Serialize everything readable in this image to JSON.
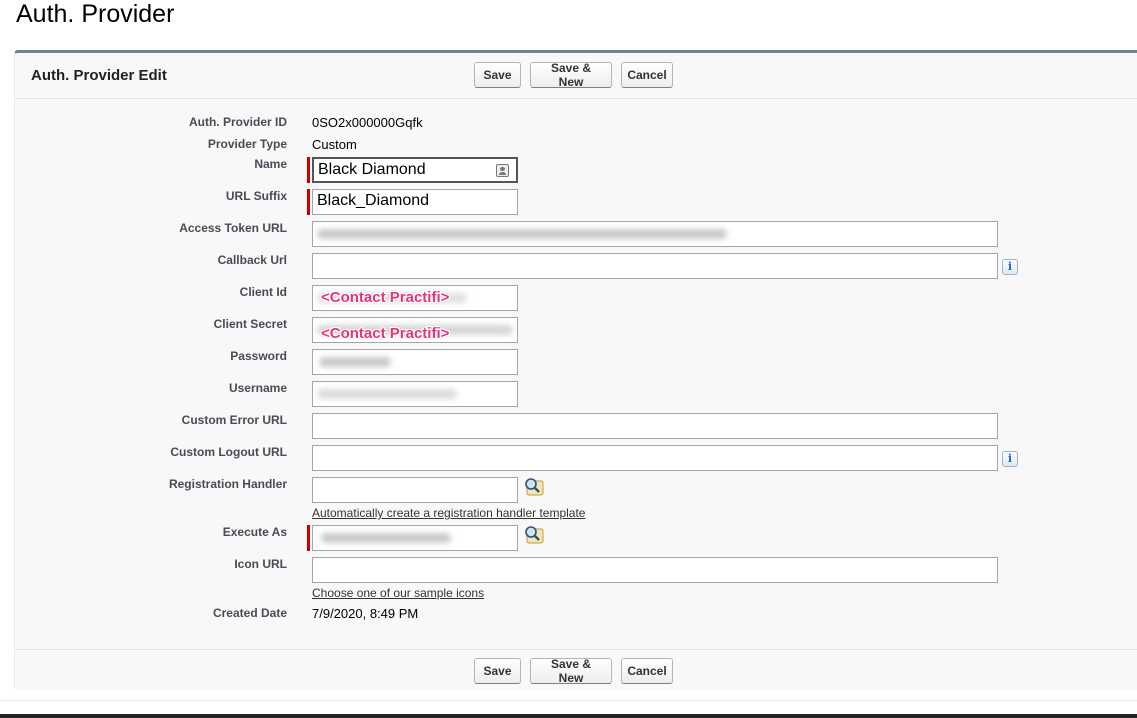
{
  "page": {
    "title": "Auth. Provider"
  },
  "panel": {
    "title": "Auth. Provider Edit"
  },
  "buttons": {
    "save": "Save",
    "save_new": "Save & New",
    "cancel": "Cancel"
  },
  "fields": {
    "auth_provider_id": {
      "label": "Auth. Provider ID",
      "value": "0SO2x000000Gqfk"
    },
    "provider_type": {
      "label": "Provider Type",
      "value": "Custom"
    },
    "name": {
      "label": "Name",
      "value": "Black Diamond",
      "required": true
    },
    "url_suffix": {
      "label": "URL Suffix",
      "value": "Black_Diamond",
      "required": true
    },
    "access_token_url": {
      "label": "Access Token URL"
    },
    "callback_url": {
      "label": "Callback Url",
      "value": ""
    },
    "client_id": {
      "label": "Client Id",
      "value": "<Contact Practifi>"
    },
    "client_secret": {
      "label": "Client Secret",
      "value": "<Contact Practifi>"
    },
    "password": {
      "label": "Password"
    },
    "username": {
      "label": "Username"
    },
    "custom_error_url": {
      "label": "Custom Error URL",
      "value": ""
    },
    "custom_logout_url": {
      "label": "Custom Logout URL",
      "value": ""
    },
    "registration_handler": {
      "label": "Registration Handler",
      "value": "",
      "link": "Automatically create a registration handler template"
    },
    "execute_as": {
      "label": "Execute As",
      "required": true
    },
    "icon_url": {
      "label": "Icon URL",
      "value": "",
      "link": "Choose one of our sample icons"
    },
    "created_date": {
      "label": "Created Date",
      "value": "7/9/2020, 8:49 PM"
    }
  },
  "icons": {
    "info": "info-icon",
    "lookup": "magnifier-lookup-icon",
    "contact": "contact-card-icon"
  },
  "colors": {
    "required_bar": "#cc0000",
    "stamp": "#e4347a",
    "panel_border": "#747e96"
  }
}
